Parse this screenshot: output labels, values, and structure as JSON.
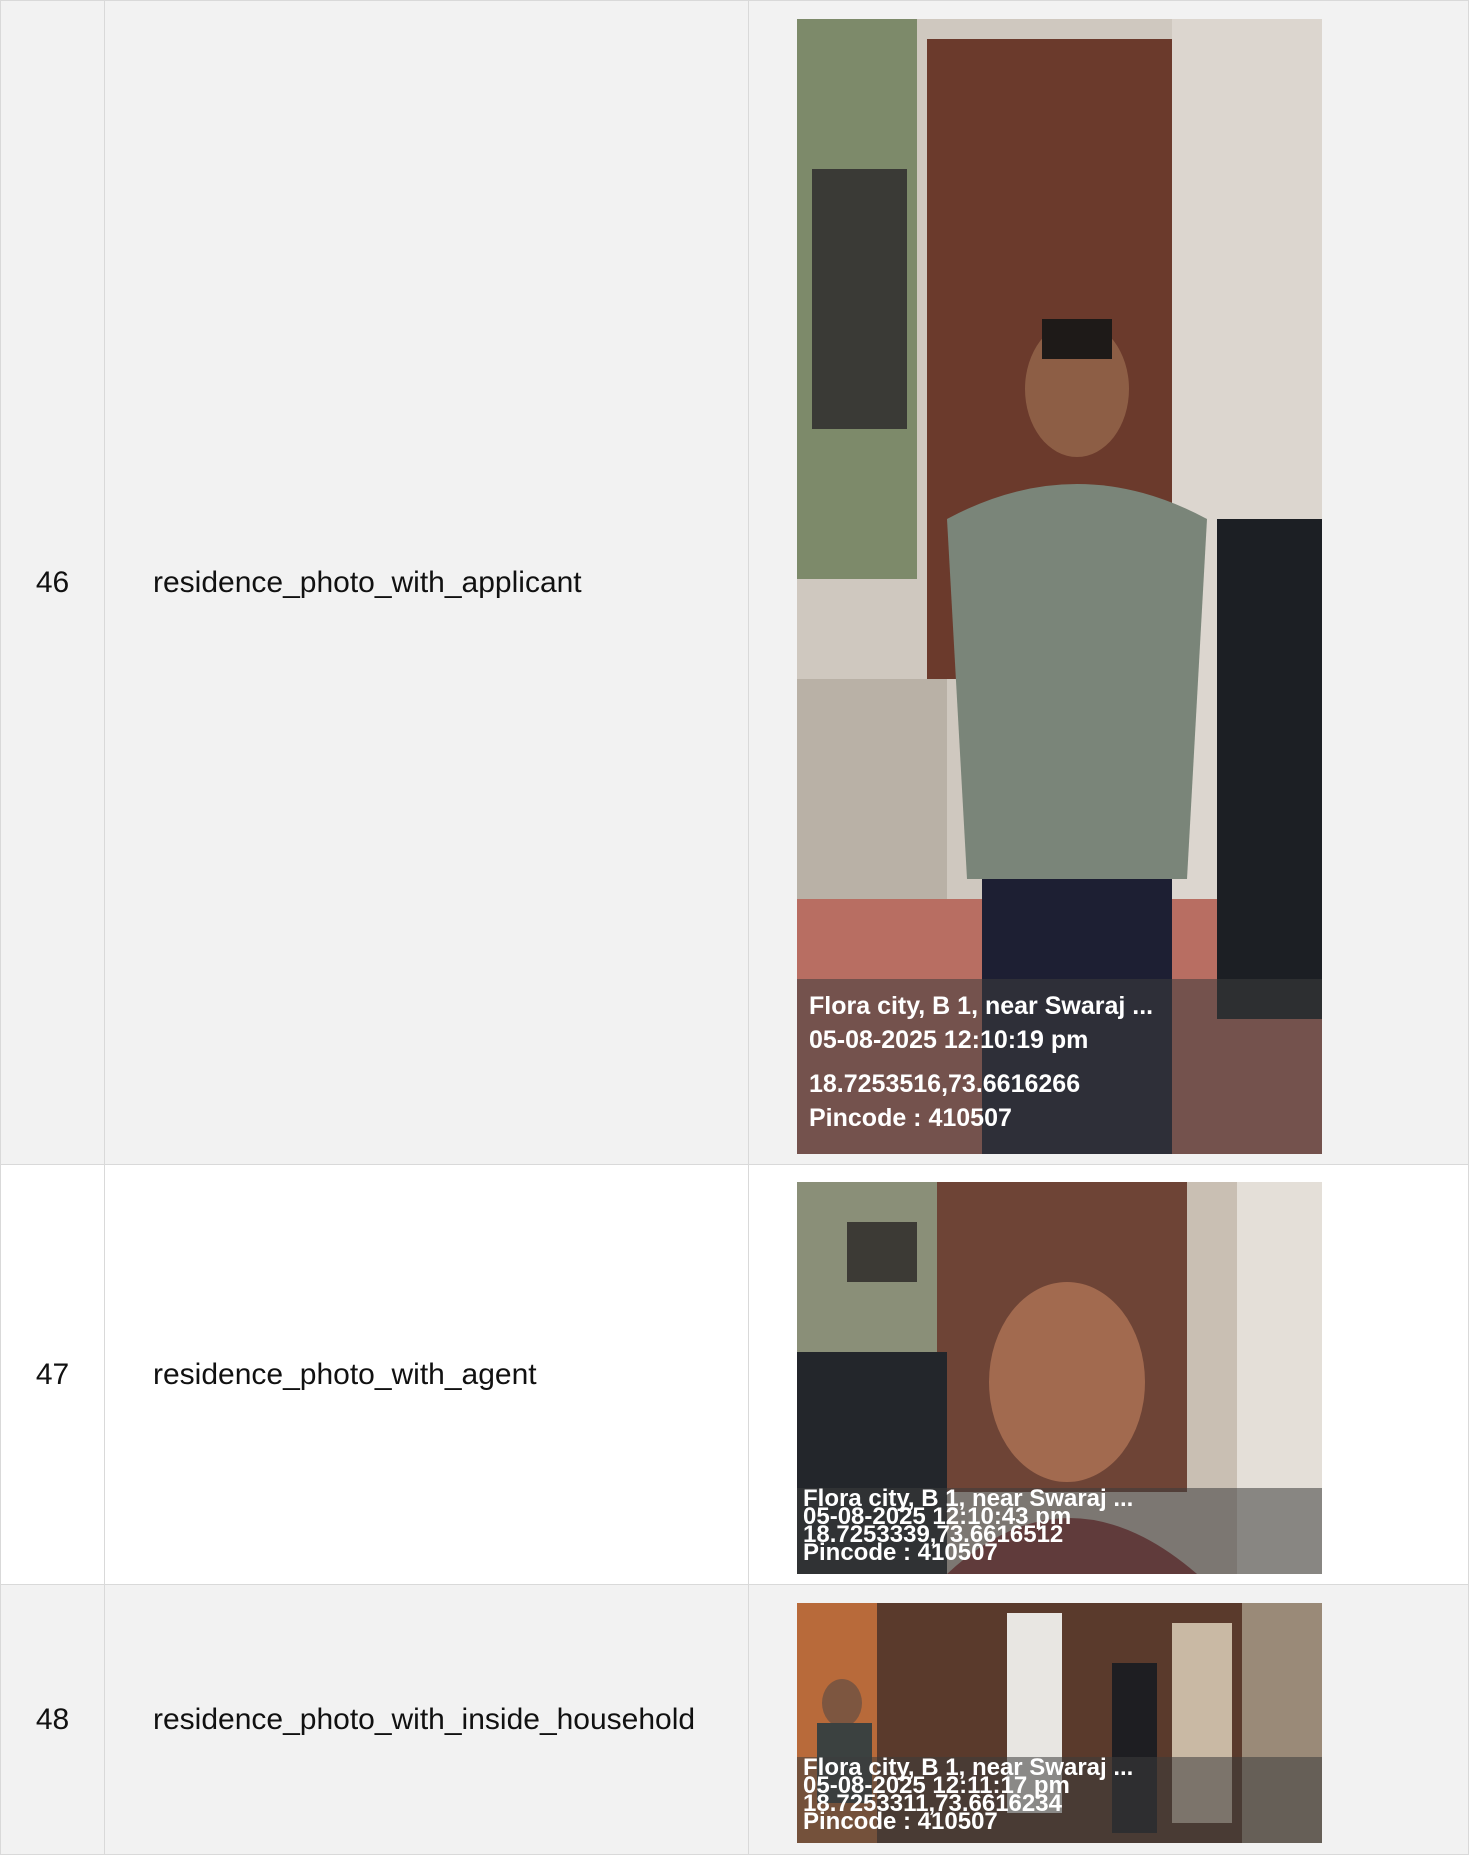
{
  "rows": [
    {
      "number": "46",
      "label": "residence_photo_with_applicant",
      "overlay": {
        "address": "Flora city, B 1, near Swaraj ...",
        "datetime": "05-08-2025 12:10:19 pm",
        "coords": "18.7253516,73.6616266",
        "pincode": "Pincode : 410507"
      }
    },
    {
      "number": "47",
      "label": "residence_photo_with_agent",
      "overlay": {
        "address": "Flora city, B 1, near Swaraj ...",
        "datetime": "05-08-2025 12:10:43 pm",
        "coords": "18.7253339,73.6616512",
        "pincode": "Pincode : 410507"
      }
    },
    {
      "number": "48",
      "label": "residence_photo_with_inside_household",
      "overlay": {
        "address": "Flora city, B 1, near Swaraj ...",
        "datetime": "05-08-2025 12:11:17 pm",
        "coords": "18.7253311,73.6616234",
        "pincode": "Pincode : 410507"
      }
    }
  ]
}
